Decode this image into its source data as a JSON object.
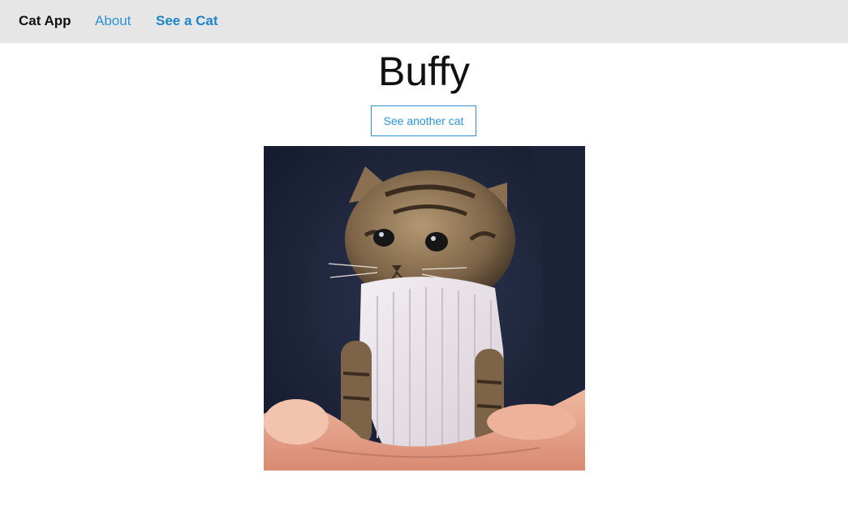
{
  "navbar": {
    "brand": "Cat App",
    "links": [
      {
        "label": "About"
      },
      {
        "label": "See a Cat"
      }
    ]
  },
  "main": {
    "cat_name": "Buffy",
    "another_button": "See another cat"
  },
  "colors": {
    "navbar_bg": "#e6e6e6",
    "link": "#2b93d8",
    "active_link": "#1f84c9",
    "text": "#111111"
  }
}
